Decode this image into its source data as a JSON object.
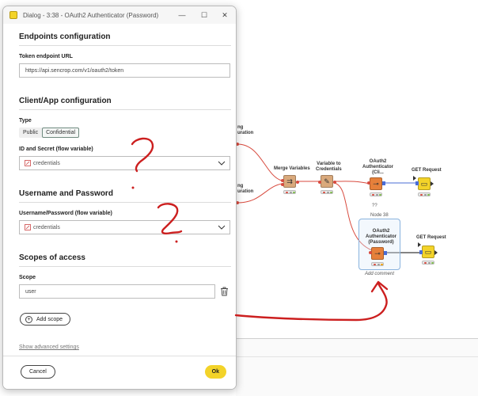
{
  "window": {
    "title": "Dialog - 3:38 - OAuth2 Authenticator (Password)",
    "controls": [
      "minimize",
      "maximize",
      "close"
    ]
  },
  "sections": {
    "endpoints": {
      "title": "Endpoints configuration",
      "token_label": "Token endpoint URL",
      "token_value": "https://api.sencrop.com/v1/oauth2/token"
    },
    "client": {
      "title": "Client/App configuration",
      "type_label": "Type",
      "type_options": [
        "Public",
        "Confidential"
      ],
      "type_selected": "Confidential",
      "id_secret_label": "ID and Secret (flow variable)",
      "id_secret_value": "credentials"
    },
    "userpass": {
      "title": "Username and Password",
      "label": "Username/Password (flow variable)",
      "value": "credentials"
    },
    "scopes": {
      "title": "Scopes of access",
      "scope_label": "Scope",
      "scope_value": "user",
      "add_label": "Add scope"
    }
  },
  "advanced_link": "Show advanced settings",
  "footer": {
    "cancel_label": "Cancel",
    "ok_label": "Ok"
  },
  "workflow": {
    "partial_label_1": "ng\nuration",
    "partial_label_2": "ng\nuration",
    "merge_label": "Merge Variables",
    "var_cred_label": "Variable to\nCredentials",
    "oauth_top_label": "OAuth2\nAuthenticator\n(Cli...",
    "get_top_label": "GET Request",
    "q_mark": "??",
    "node_id": "Node 38",
    "oauth_pwd_label": "OAuth2\nAuthenticator\n(Password)",
    "get_bottom_label": "GET Request",
    "add_comment": "Add comment"
  },
  "colors": {
    "accent_yellow": "#f3d329",
    "annotation_red": "#cc1f1f",
    "connection_red": "#d84a3e",
    "port_blue": "#4a6dd6"
  },
  "icons": [
    "flow-variable-icon",
    "chevron-down-icon",
    "trash-icon",
    "plus-circle-icon"
  ]
}
